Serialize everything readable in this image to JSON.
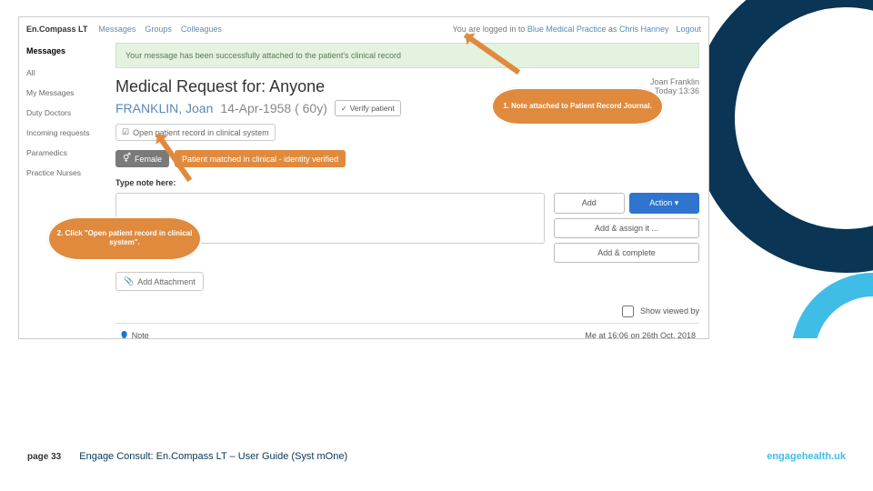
{
  "topbar": {
    "brand": "En.Compass LT",
    "nav": [
      "Messages",
      "Groups",
      "Colleagues"
    ],
    "login_prefix": "You are logged in to",
    "practice": "Blue Medical Practice",
    "login_as": "as",
    "user": "Chris Hanney",
    "logout": "Logout"
  },
  "sidebar": {
    "heading": "Messages",
    "items": [
      "All",
      "My Messages",
      "Duty Doctors",
      "Incoming requests",
      "Paramedics",
      "Practice Nurses"
    ]
  },
  "banner": "Your message has been successfully attached to the patient's clinical record",
  "request": {
    "title": "Medical Request for: Anyone",
    "caller_name": "Joan Franklin",
    "caller_time": "Today 13:36"
  },
  "patient": {
    "name": "FRANKLIN, Joan",
    "dob": "14-Apr-1958 ( 60y)",
    "verify": "Verify patient",
    "open_record": "Open patient record in clinical system",
    "badge_female": "Female",
    "badge_matched": "Patient matched in clinical - identity verified"
  },
  "notes": {
    "label": "Type note here:",
    "add": "Add",
    "action": "Action",
    "assign": "Add & assign it ...",
    "complete": "Add & complete",
    "attach": "Add Attachment"
  },
  "viewed": {
    "label": "Show viewed by"
  },
  "noterow": {
    "label": "Note",
    "meta": "Me at 16:06 on 26th Oct, 2018"
  },
  "callouts": {
    "c1": "1. Note attached to Patient Record Journal.",
    "c2": "2. Click \"Open patient record in clinical system\"."
  },
  "footer": {
    "page": "page 33",
    "title": "Engage Consult: En.Compass LT – User Guide (Syst mOne)",
    "url": "engagehealth.uk"
  }
}
